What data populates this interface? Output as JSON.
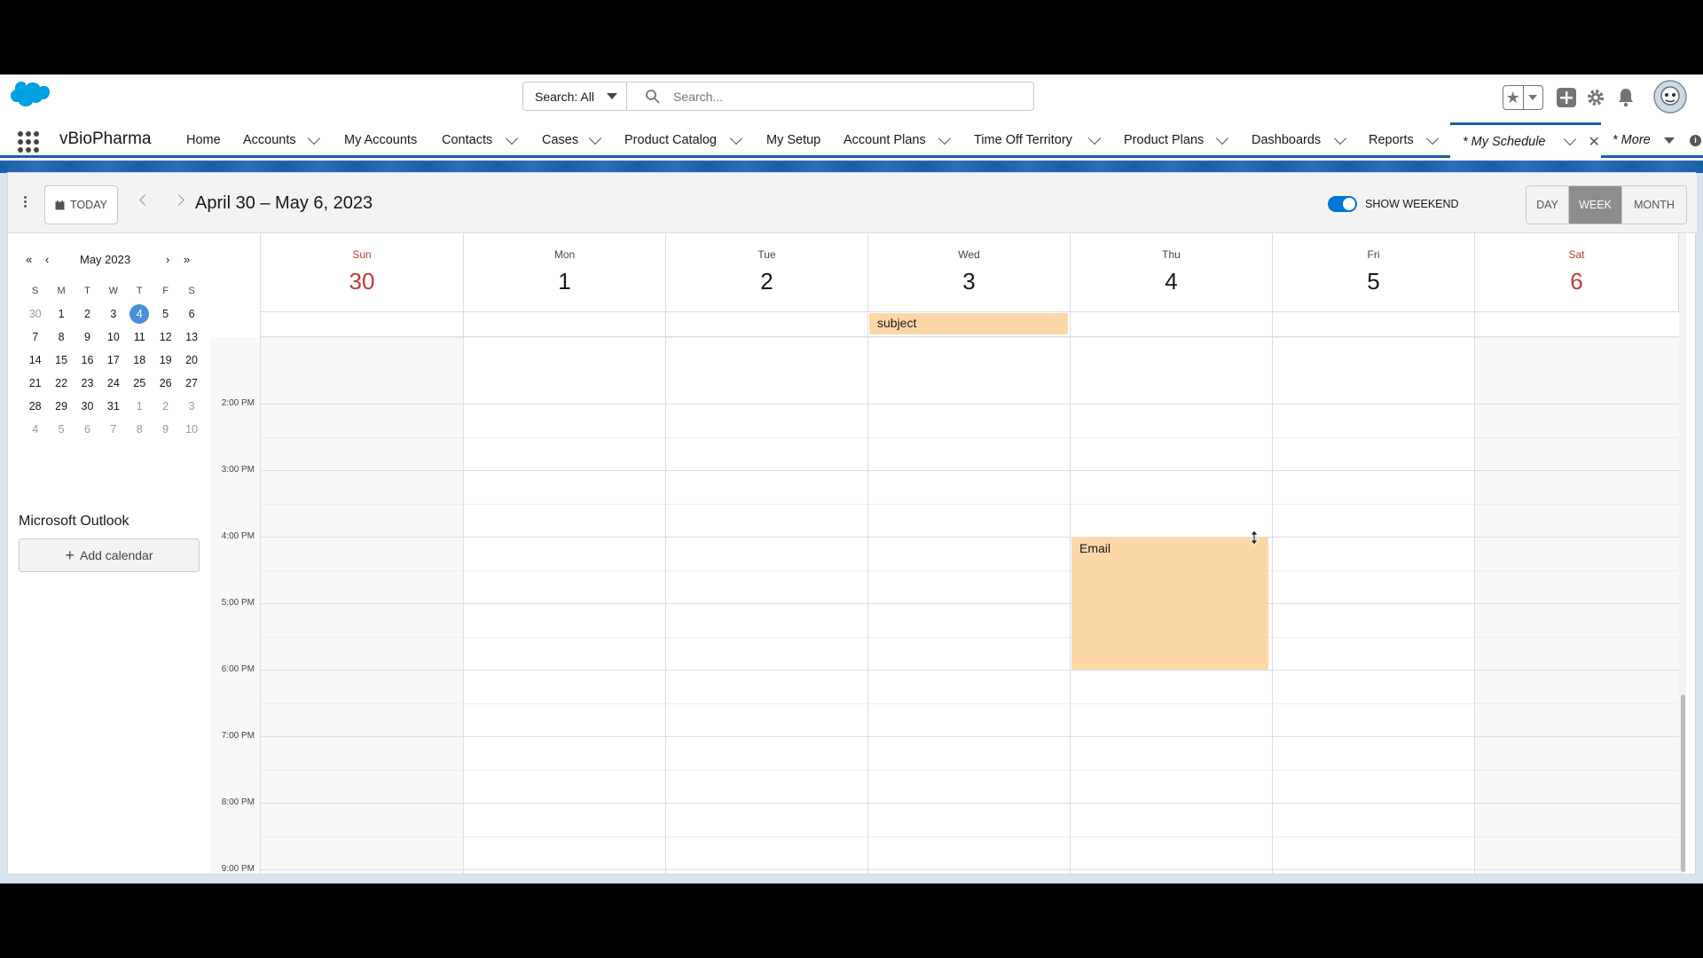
{
  "header": {
    "search_scope": "Search: All",
    "search_placeholder": "Search...",
    "app_name": "vBioPharma"
  },
  "nav": {
    "items": [
      {
        "label": "Home"
      },
      {
        "label": "Accounts"
      },
      {
        "label": "My Accounts"
      },
      {
        "label": "Contacts"
      },
      {
        "label": "Cases"
      },
      {
        "label": "Product Catalog"
      },
      {
        "label": "My Setup"
      },
      {
        "label": "Account Plans"
      },
      {
        "label": "Time Off Territory"
      },
      {
        "label": "Product Plans"
      },
      {
        "label": "Dashboards"
      },
      {
        "label": "Reports"
      }
    ],
    "active_tab": "* My Schedule",
    "more": "* More"
  },
  "toolbar": {
    "today": "TODAY",
    "range": "April 30 – May 6, 2023",
    "show_weekend": "SHOW WEEKEND",
    "views": [
      "DAY",
      "WEEK",
      "MONTH"
    ],
    "selected_view": "WEEK"
  },
  "mini_calendar": {
    "month": "May 2023",
    "weekdays": [
      "S",
      "M",
      "T",
      "W",
      "T",
      "F",
      "S"
    ],
    "weeks": [
      [
        "30",
        "1",
        "2",
        "3",
        "4",
        "5",
        "6"
      ],
      [
        "7",
        "8",
        "9",
        "10",
        "11",
        "12",
        "13"
      ],
      [
        "14",
        "15",
        "16",
        "17",
        "18",
        "19",
        "20"
      ],
      [
        "21",
        "22",
        "23",
        "24",
        "25",
        "26",
        "27"
      ],
      [
        "28",
        "29",
        "30",
        "31",
        "1",
        "2",
        "3"
      ],
      [
        "4",
        "5",
        "6",
        "7",
        "8",
        "9",
        "10"
      ]
    ],
    "today": "4"
  },
  "sidebar": {
    "section_title": "Microsoft Outlook",
    "add_calendar": "Add calendar"
  },
  "week": {
    "days": [
      {
        "dow": "Sun",
        "num": "30"
      },
      {
        "dow": "Mon",
        "num": "1"
      },
      {
        "dow": "Tue",
        "num": "2"
      },
      {
        "dow": "Wed",
        "num": "3"
      },
      {
        "dow": "Thu",
        "num": "4"
      },
      {
        "dow": "Fri",
        "num": "5"
      },
      {
        "dow": "Sat",
        "num": "6"
      }
    ],
    "times": [
      "2:00 PM",
      "3:00 PM",
      "4:00 PM",
      "5:00 PM",
      "6:00 PM",
      "7:00 PM",
      "8:00 PM",
      "9:00 PM"
    ],
    "events": [
      {
        "title": "subject",
        "day": "Wed"
      },
      {
        "title": "Email",
        "day": "Thu",
        "start": "4:00 PM",
        "end": "6:00 PM"
      }
    ]
  },
  "colors": {
    "brand": "#0176d3",
    "nav_accent": "#1b5fa8",
    "weekend_red": "#c23934",
    "event": "#fcd8a8"
  }
}
